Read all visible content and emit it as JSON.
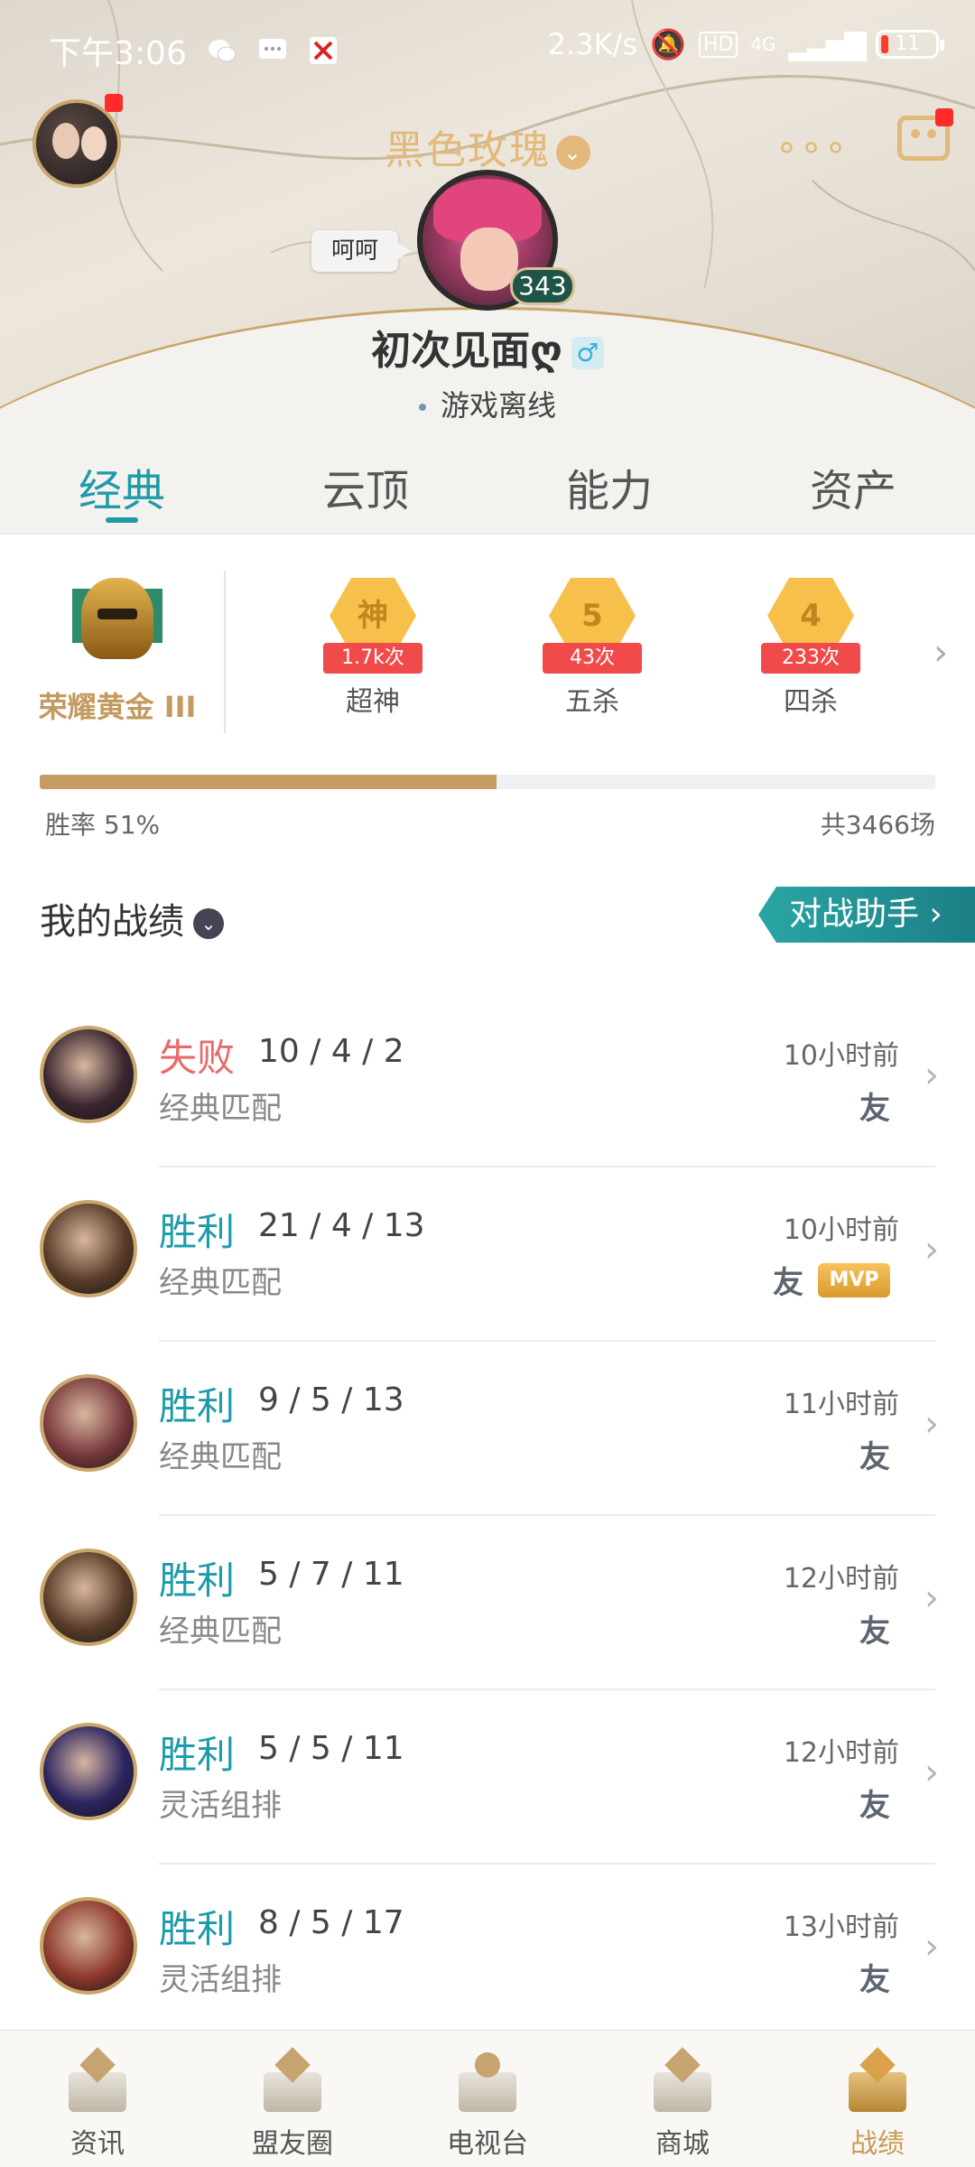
{
  "status_bar": {
    "time": "下午3:06",
    "net_speed": "2.3K/s",
    "hd": "HD",
    "signal": "4G",
    "battery": "11"
  },
  "header": {
    "rank_title": "黑色玫瑰",
    "speech_bubble": "呵呵",
    "level": "343",
    "nickname": "初次见面ღ",
    "gender_symbol": "♂",
    "online_status": "游戏离线"
  },
  "tabs": [
    {
      "label": "经典",
      "active": true
    },
    {
      "label": "云顶",
      "active": false
    },
    {
      "label": "能力",
      "active": false
    },
    {
      "label": "资产",
      "active": false
    }
  ],
  "stats": {
    "rank_name": "荣耀黄金 III",
    "badges": [
      {
        "icon_text": "神",
        "count": "1.7k次",
        "label": "超神"
      },
      {
        "icon_text": "5",
        "count": "43次",
        "label": "五杀"
      },
      {
        "icon_text": "4",
        "count": "233次",
        "label": "四杀"
      }
    ],
    "win_rate_label": "胜率  51%",
    "win_rate": 0.51,
    "total_games": "共3466场"
  },
  "section": {
    "title": "我的战绩",
    "helper_button": "对战助手 ›"
  },
  "matches": [
    {
      "result": "失败",
      "outcome": "loss",
      "kda": "10 / 4 / 2",
      "mode": "经典匹配",
      "time": "10小时前",
      "friend": "友",
      "mvp": null,
      "avatar_color": "#3b2730"
    },
    {
      "result": "胜利",
      "outcome": "win",
      "kda": "21 / 4 / 13",
      "mode": "经典匹配",
      "time": "10小时前",
      "friend": "友",
      "mvp": "MVP",
      "avatar_color": "#5a3d2a"
    },
    {
      "result": "胜利",
      "outcome": "win",
      "kda": "9 / 5 / 13",
      "mode": "经典匹配",
      "time": "11小时前",
      "friend": "友",
      "mvp": null,
      "avatar_color": "#7a3b3d"
    },
    {
      "result": "胜利",
      "outcome": "win",
      "kda": "5 / 7 / 11",
      "mode": "经典匹配",
      "time": "12小时前",
      "friend": "友",
      "mvp": null,
      "avatar_color": "#5a3d2a"
    },
    {
      "result": "胜利",
      "outcome": "win",
      "kda": "5 / 5 / 11",
      "mode": "灵活组排",
      "time": "12小时前",
      "friend": "友",
      "mvp": null,
      "avatar_color": "#2c2560"
    },
    {
      "result": "胜利",
      "outcome": "win",
      "kda": "8 / 5 / 17",
      "mode": "灵活组排",
      "time": "13小时前",
      "friend": "友",
      "mvp": null,
      "avatar_color": "#8e3a2e"
    }
  ],
  "bottom_nav": [
    {
      "label": "资讯",
      "active": false
    },
    {
      "label": "盟友圈",
      "active": false
    },
    {
      "label": "电视台",
      "active": false
    },
    {
      "label": "商城",
      "active": false
    },
    {
      "label": "战绩",
      "active": true
    }
  ],
  "colors": {
    "accent_teal": "#1f9aa8",
    "gold": "#c9a66b",
    "win": "#1b9cab",
    "loss": "#e86a6a"
  }
}
